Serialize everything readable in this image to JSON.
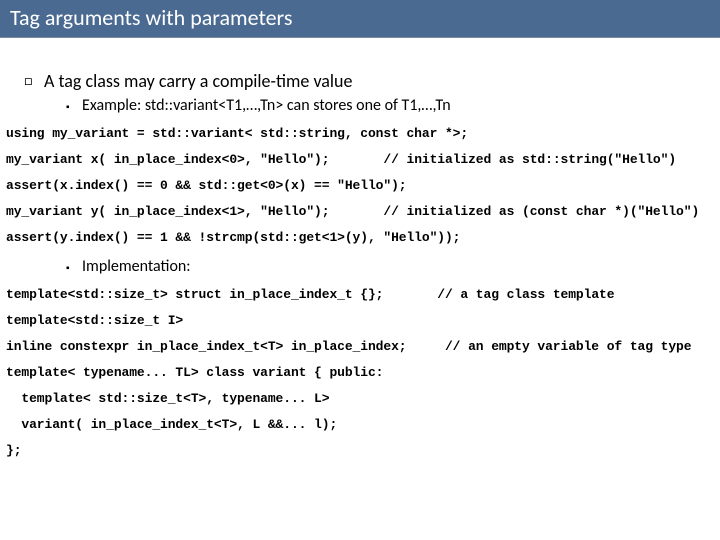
{
  "title": "Tag arguments with parameters",
  "bullets": {
    "l1_1": "A tag class may carry a compile-time value",
    "l2_1": "Example: std::variant<T1,…,Tn> can stores one of T1,…,Tn",
    "l2_2": "Implementation:"
  },
  "code1": {
    "line1": "using my_variant = std::variant< std::string, const char *>;",
    "line2a": "my_variant x( in_place_index<0>, \"Hello\");",
    "line2b": "// initialized as std::string(\"Hello\")",
    "line3": "assert(x.index() == 0 && std::get<0>(x) == \"Hello\");",
    "line4a": "my_variant y( in_place_index<1>, \"Hello\");",
    "line4b": "// initialized as (const char *)(\"Hello\")",
    "line5": "assert(y.index() == 1 && !strcmp(std::get<1>(y), \"Hello\"));"
  },
  "code2": {
    "line1a": "template<std::size_t> struct in_place_index_t {};",
    "line1b": "// a tag class template",
    "line2": "template<std::size_t I>",
    "line3a": "inline constexpr in_place_index_t<T> in_place_index;",
    "line3b": "// an empty variable of tag type",
    "line4": "template< typename... TL> class variant { public:",
    "line5": "  template< std::size_t<T>, typename... L>",
    "line6": "  variant( in_place_index_t<T>, L &&... l);",
    "line7": "};"
  }
}
